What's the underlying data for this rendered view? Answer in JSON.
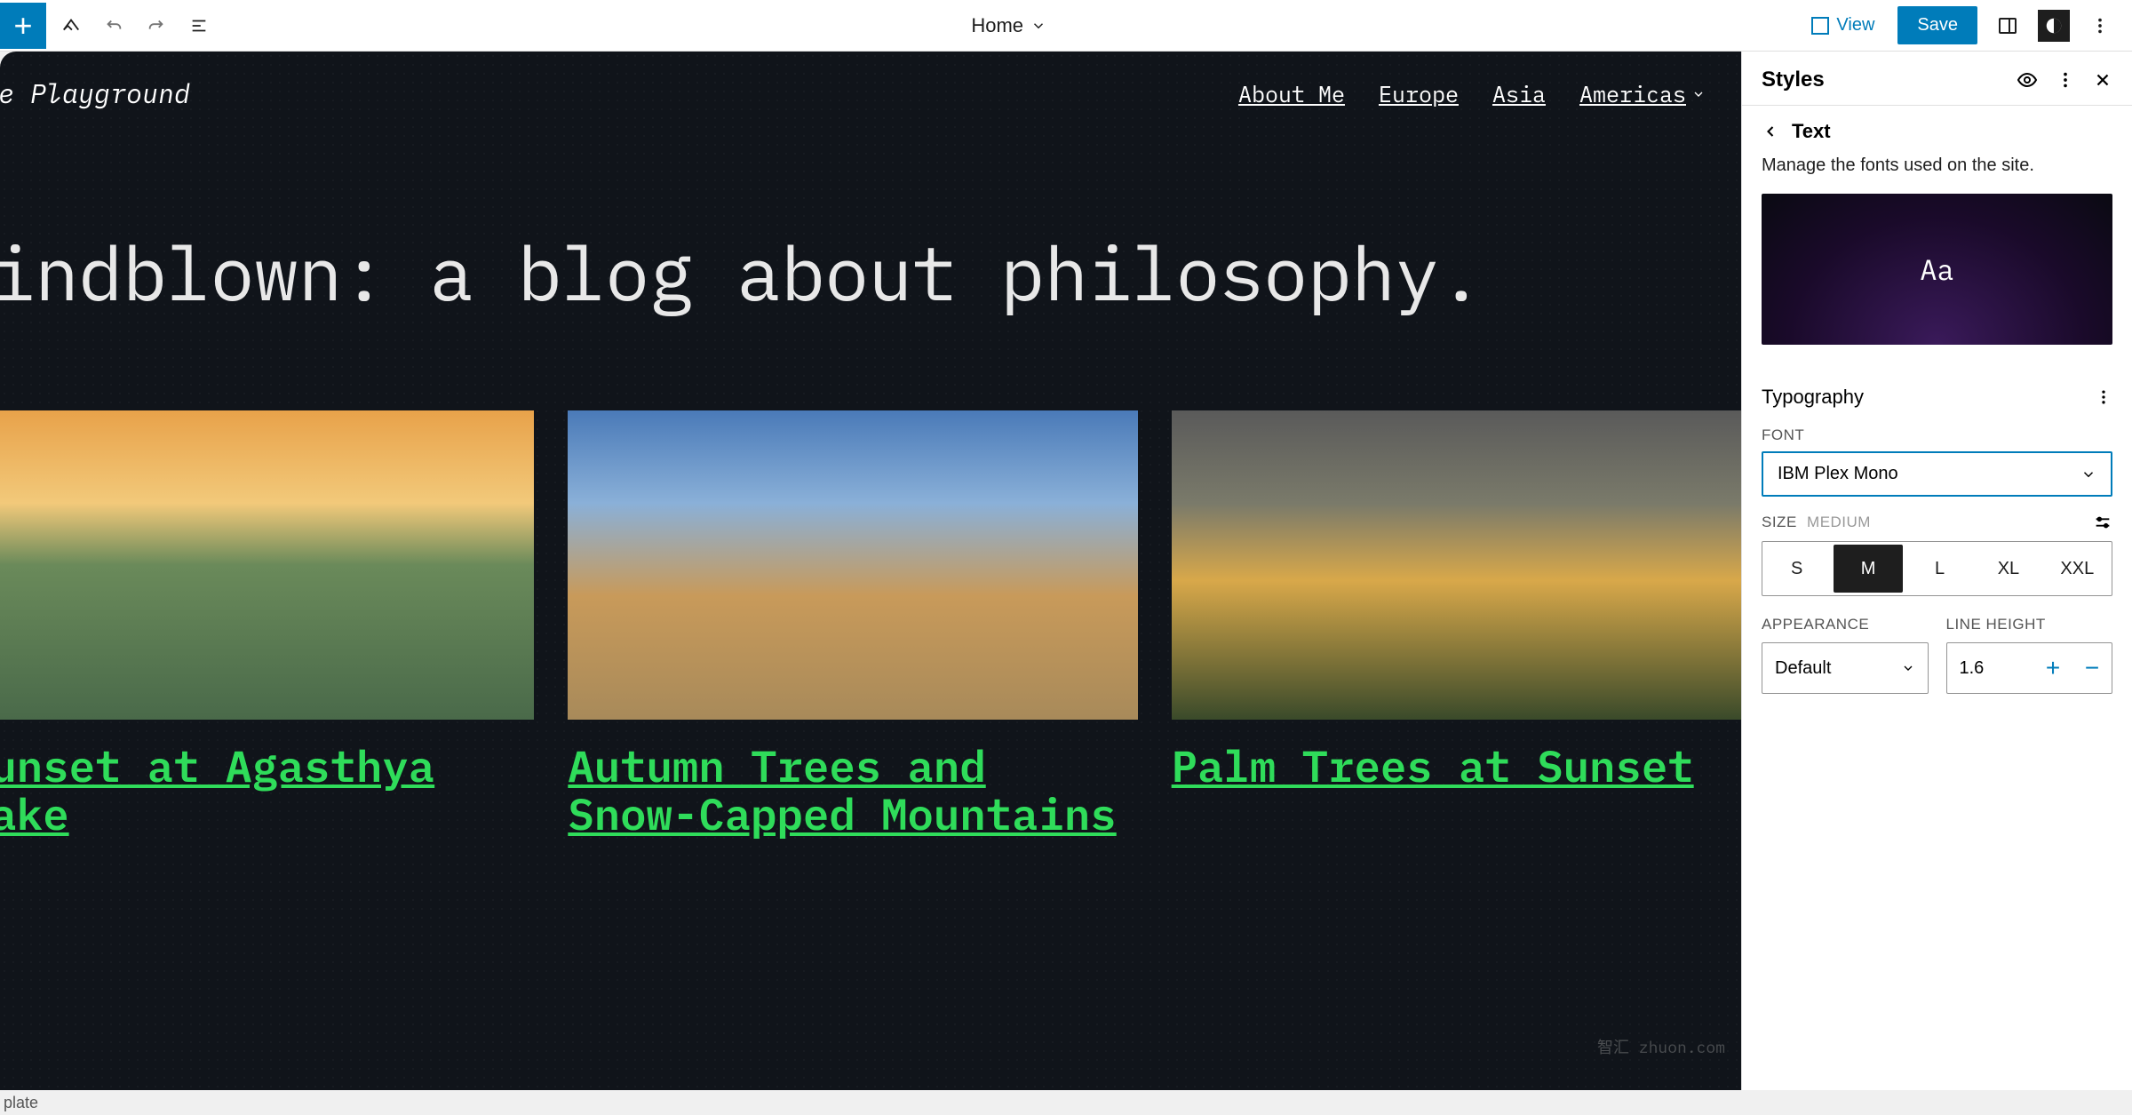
{
  "toolbar": {
    "template_name": "Home",
    "view_label": "View",
    "save_label": "Save"
  },
  "canvas": {
    "site_title": "he Playground",
    "nav": [
      "About Me",
      "Europe",
      "Asia",
      "Americas"
    ],
    "hero": "Mindblown: a blog about philosophy.",
    "posts": [
      {
        "title": "Sunset at Agasthya Lake"
      },
      {
        "title": "Autumn Trees and Snow-Capped Mountains"
      },
      {
        "title": "Palm Trees at Sunset"
      }
    ],
    "footer_strip": "plate"
  },
  "sidebar": {
    "header": "Styles",
    "crumb": "Text",
    "desc": "Manage the fonts used on the site.",
    "preview_text": "Aa",
    "typography": {
      "heading": "Typography",
      "font_label": "FONT",
      "font_value": "IBM Plex Mono",
      "size_label": "SIZE",
      "size_value_label": "MEDIUM",
      "sizes": [
        "S",
        "M",
        "L",
        "XL",
        "XXL"
      ],
      "size_active": "M",
      "appearance_label": "APPEARANCE",
      "appearance_value": "Default",
      "line_height_label": "LINE HEIGHT",
      "line_height_value": "1.6"
    }
  },
  "watermark": "智汇 zhuon.com"
}
